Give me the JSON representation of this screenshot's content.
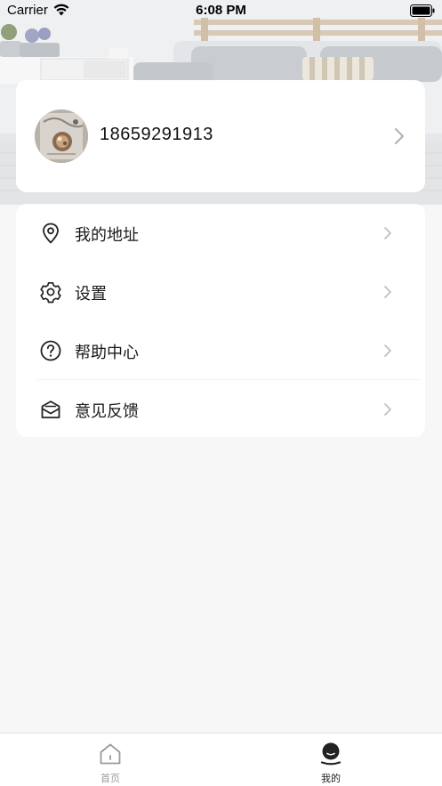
{
  "status_bar": {
    "carrier": "Carrier",
    "time": "6:08 PM",
    "wifi_icon": "wifi-icon",
    "battery_icon": "battery-full-icon"
  },
  "profile": {
    "phone": "18659291913",
    "avatar_icon": "user-avatar",
    "chevron_icon": "chevron-right-icon"
  },
  "menu": {
    "items": [
      {
        "label": "我的地址",
        "icon": "location-pin-icon"
      },
      {
        "label": "设置",
        "icon": "gear-icon"
      },
      {
        "label": "帮助中心",
        "icon": "help-circle-icon"
      },
      {
        "label": "意见反馈",
        "icon": "feedback-mail-icon"
      }
    ]
  },
  "tab_bar": {
    "tabs": [
      {
        "label": "首页",
        "icon": "home-icon",
        "active": false
      },
      {
        "label": "我的",
        "icon": "profile-icon",
        "active": true
      }
    ]
  },
  "colors": {
    "page_background": "#f7f7f7",
    "card_background": "#ffffff",
    "tab_inactive": "#9a9a9a",
    "tab_active": "#222222"
  }
}
